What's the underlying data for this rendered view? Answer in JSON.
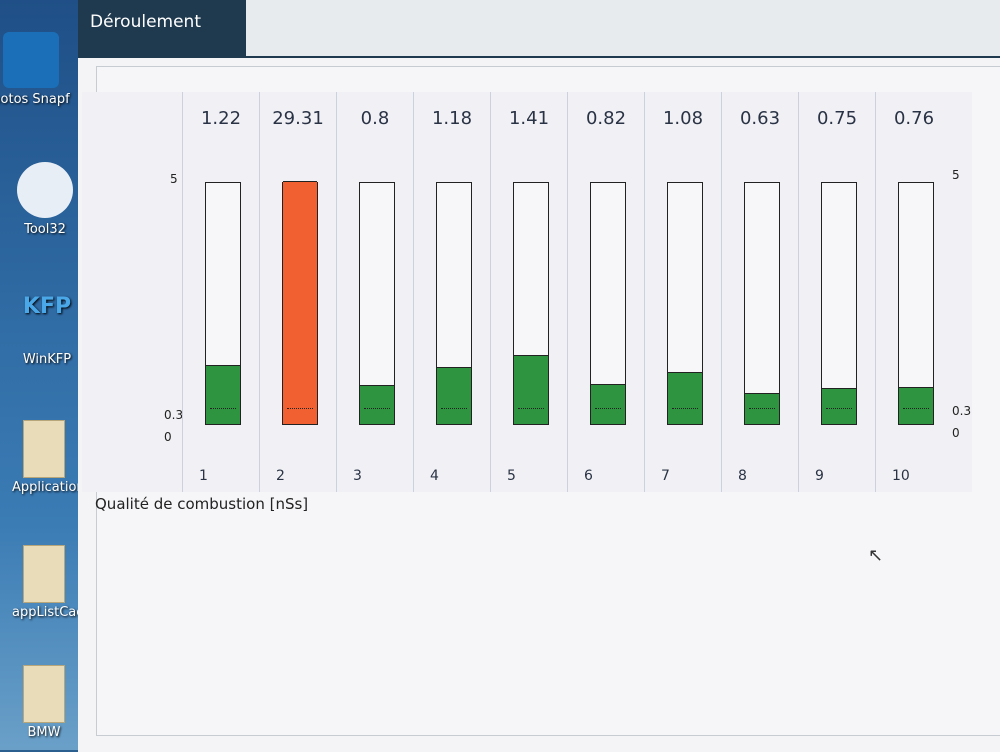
{
  "desktop": {
    "icons": [
      {
        "label": "hotos Snapf"
      },
      {
        "label": "Tool32"
      },
      {
        "label": "WinKFP"
      },
      {
        "label": "Application"
      },
      {
        "label": "appListCach"
      },
      {
        "label": "BMW"
      }
    ]
  },
  "window": {
    "tab_label": "Déroulement"
  },
  "chart_data": {
    "type": "bar",
    "xlabel": "Qualité de combustion [nSs]",
    "ylim": [
      0,
      5
    ],
    "y_ticks_left": [
      "5",
      "0.3",
      "0"
    ],
    "y_ticks_right": [
      "5",
      "0.3",
      "0"
    ],
    "threshold": 0.3,
    "categories": [
      "1",
      "2",
      "3",
      "4",
      "5",
      "6",
      "7",
      "8",
      "9",
      "10"
    ],
    "values": [
      1.22,
      29.31,
      0.8,
      1.18,
      1.41,
      0.82,
      1.08,
      0.63,
      0.75,
      0.76
    ],
    "value_labels": [
      "1.22",
      "29.31",
      "0.8",
      "1.18",
      "1.41",
      "0.82",
      "1.08",
      "0.63",
      "0.75",
      "0.76"
    ],
    "colors": {
      "ok": "#2e9440",
      "bad": "#f06030"
    }
  }
}
